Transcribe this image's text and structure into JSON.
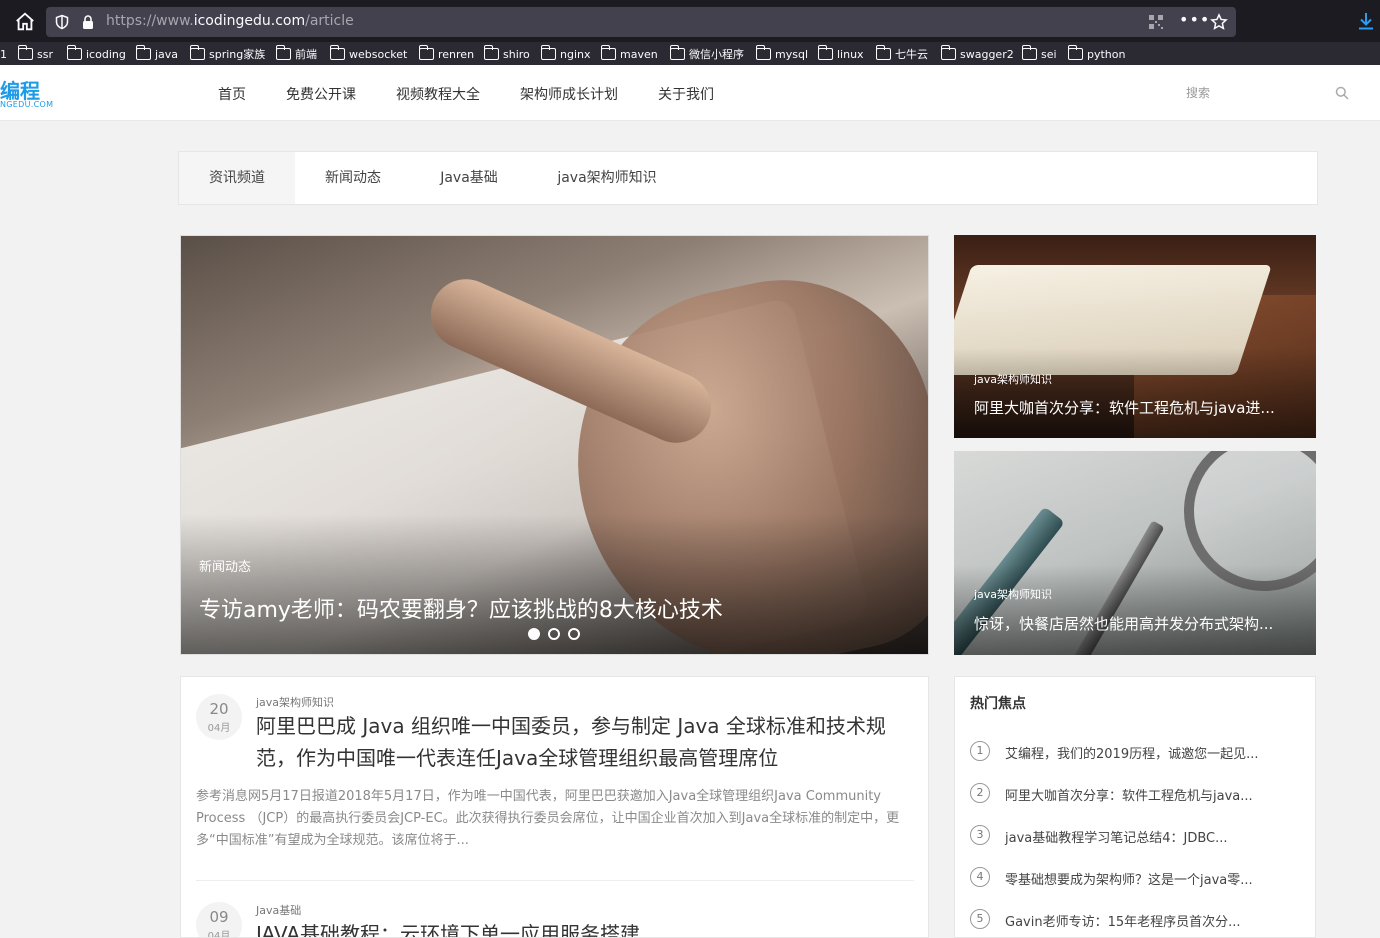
{
  "browser": {
    "url_prefix": "https://www.",
    "url_domain": "icodingedu.com",
    "url_path": "/article",
    "bookmarks": [
      "1",
      "ssr",
      "icoding",
      "java",
      "spring家族",
      "前端",
      "websocket",
      "renren",
      "shiro",
      "nginx",
      "maven",
      "微信小程序",
      "mysql",
      "linux",
      "七牛云",
      "swagger2",
      "sei",
      "python"
    ]
  },
  "site": {
    "logo_text": "编程",
    "logo_sub": "NGEDU.COM",
    "nav": [
      "首页",
      "免费公开课",
      "视频教程大全",
      "架构师成长计划",
      "关于我们"
    ],
    "search_placeholder": "搜索"
  },
  "tabs": [
    "资讯频道",
    "新闻动态",
    "Java基础",
    "java架构师知识"
  ],
  "slider": {
    "tag": "新闻动态",
    "title": "专访amy老师：码农要翻身？应该挑战的8大核心技术",
    "dots": 3,
    "active_dot": 1
  },
  "cards": [
    {
      "tag": "java架构师知识",
      "title": "阿里大咖首次分享：软件工程危机与java进..."
    },
    {
      "tag": "java架构师知识",
      "title": "惊讶，快餐店居然也能用高并发分布式架构..."
    }
  ],
  "articles": [
    {
      "day": "20",
      "month": "04月",
      "category": "java架构师知识",
      "title": "阿里巴巴成 Java 组织唯一中国委员，参与制定 Java 全球标准和技术规范，作为中国唯一代表连任Java全球管理组织最高管理席位",
      "summary": "参考消息网5月17日报道2018年5月17日，作为唯一中国代表，阿里巴巴获邀加入Java全球管理组织Java Community Process （JCP）的最高执行委员会JCP-EC。此次获得执行委员会席位，让中国企业首次加入到Java全球标准的制定中，更多“中国标准”有望成为全球规范。该席位将于..."
    },
    {
      "day": "09",
      "month": "04月",
      "category": "Java基础",
      "title": "JAVA基础教程：云环境下单一应用服务搭建"
    }
  ],
  "hot": {
    "title": "热门焦点",
    "items": [
      "艾编程，我们的2019历程，诚邀您一起见...",
      "阿里大咖首次分享：软件工程危机与java...",
      "java基础教程学习笔记总结4：JDBC...",
      "零基础想要成为架构师？这是一个java零...",
      "Gavin老师专访：15年老程序员首次分..."
    ]
  },
  "colors": {
    "accent": "#1e9be6",
    "chrome_dark": "#1c1b22",
    "chrome_bar": "#2b2a33",
    "urlbar": "#42414d",
    "page_bg": "#f2f2f2"
  }
}
